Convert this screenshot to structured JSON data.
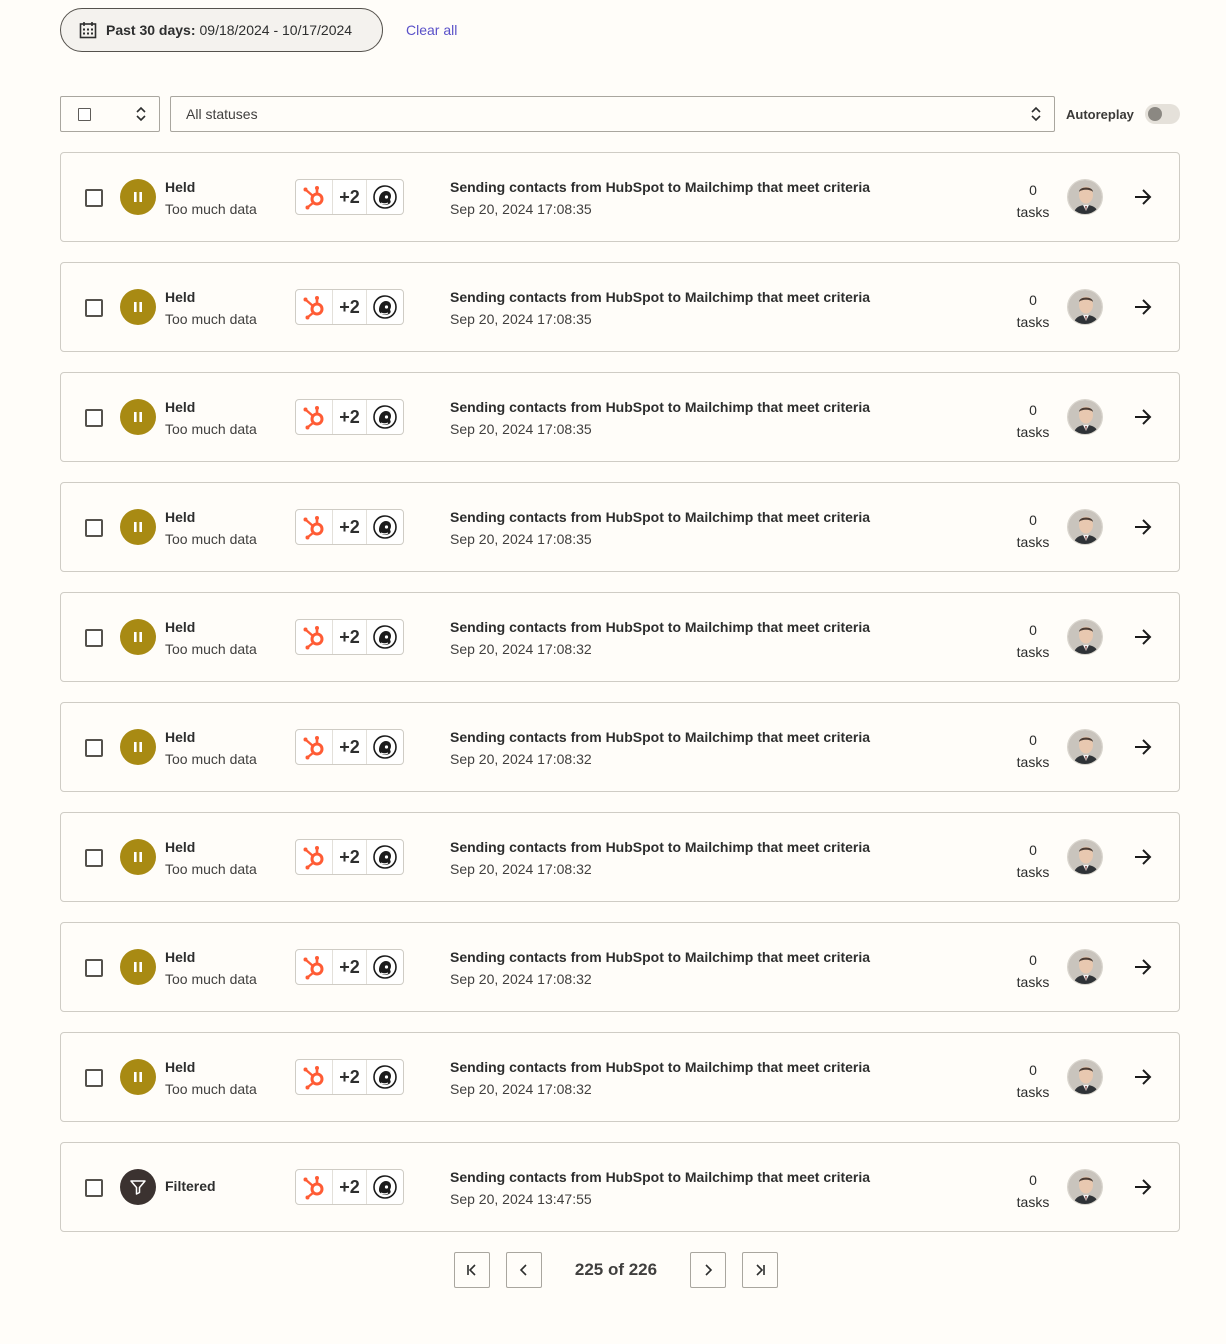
{
  "filter": {
    "date_label": "Past 30 days:",
    "date_range": "09/18/2024 - 10/17/2024",
    "clear_all": "Clear all"
  },
  "controls": {
    "status_select": "All statuses",
    "autoreplay_label": "Autoreplay",
    "autoreplay_on": false
  },
  "icons": {
    "calendar": "calendar-icon",
    "updown": "chevron-up-down-icon",
    "hubspot": "hubspot-icon",
    "mailchimp": "mailchimp-icon",
    "pause": "pause-icon",
    "filter": "filter-icon",
    "arrow": "arrow-right-icon"
  },
  "colors": {
    "held": "#a88a13",
    "filtered": "#3b3230",
    "hubspot": "#ff5c35",
    "link": "#5a51c9"
  },
  "runs": [
    {
      "status": "Held",
      "reason": "Too much data",
      "apps_more": "+2",
      "title": "Sending contacts from HubSpot to Mailchimp that meet criteria",
      "date": "Sep 20, 2024 17:08:35",
      "tasks_count": "0",
      "tasks_label": "tasks"
    },
    {
      "status": "Held",
      "reason": "Too much data",
      "apps_more": "+2",
      "title": "Sending contacts from HubSpot to Mailchimp that meet criteria",
      "date": "Sep 20, 2024 17:08:35",
      "tasks_count": "0",
      "tasks_label": "tasks"
    },
    {
      "status": "Held",
      "reason": "Too much data",
      "apps_more": "+2",
      "title": "Sending contacts from HubSpot to Mailchimp that meet criteria",
      "date": "Sep 20, 2024 17:08:35",
      "tasks_count": "0",
      "tasks_label": "tasks"
    },
    {
      "status": "Held",
      "reason": "Too much data",
      "apps_more": "+2",
      "title": "Sending contacts from HubSpot to Mailchimp that meet criteria",
      "date": "Sep 20, 2024 17:08:35",
      "tasks_count": "0",
      "tasks_label": "tasks"
    },
    {
      "status": "Held",
      "reason": "Too much data",
      "apps_more": "+2",
      "title": "Sending contacts from HubSpot to Mailchimp that meet criteria",
      "date": "Sep 20, 2024 17:08:32",
      "tasks_count": "0",
      "tasks_label": "tasks"
    },
    {
      "status": "Held",
      "reason": "Too much data",
      "apps_more": "+2",
      "title": "Sending contacts from HubSpot to Mailchimp that meet criteria",
      "date": "Sep 20, 2024 17:08:32",
      "tasks_count": "0",
      "tasks_label": "tasks"
    },
    {
      "status": "Held",
      "reason": "Too much data",
      "apps_more": "+2",
      "title": "Sending contacts from HubSpot to Mailchimp that meet criteria",
      "date": "Sep 20, 2024 17:08:32",
      "tasks_count": "0",
      "tasks_label": "tasks"
    },
    {
      "status": "Held",
      "reason": "Too much data",
      "apps_more": "+2",
      "title": "Sending contacts from HubSpot to Mailchimp that meet criteria",
      "date": "Sep 20, 2024 17:08:32",
      "tasks_count": "0",
      "tasks_label": "tasks"
    },
    {
      "status": "Held",
      "reason": "Too much data",
      "apps_more": "+2",
      "title": "Sending contacts from HubSpot to Mailchimp that meet criteria",
      "date": "Sep 20, 2024 17:08:32",
      "tasks_count": "0",
      "tasks_label": "tasks"
    },
    {
      "status": "Filtered",
      "reason": "",
      "apps_more": "+2",
      "title": "Sending contacts from HubSpot to Mailchimp that meet criteria",
      "date": "Sep 20, 2024 13:47:55",
      "tasks_count": "0",
      "tasks_label": "tasks"
    }
  ],
  "pagination": {
    "label": "225 of 226"
  }
}
